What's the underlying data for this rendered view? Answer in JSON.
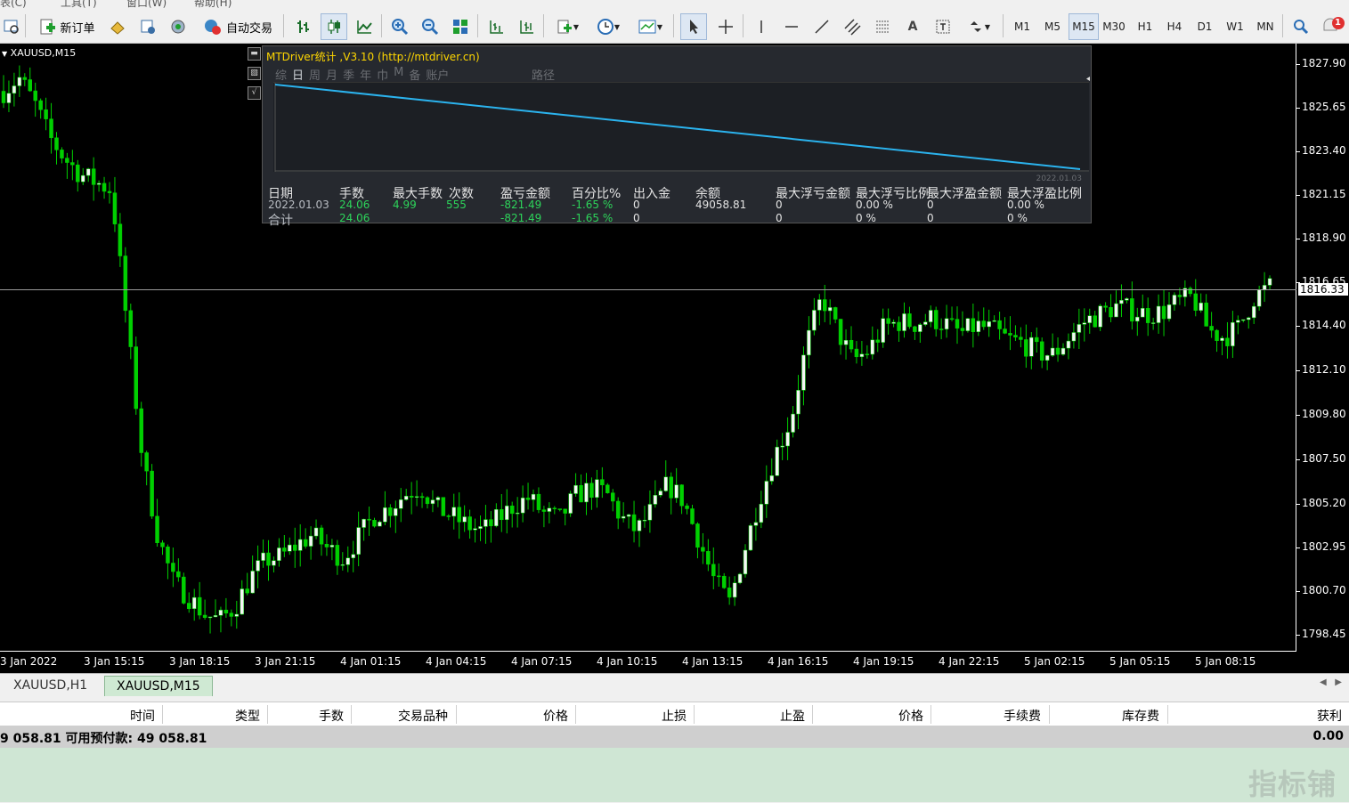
{
  "menubar": {
    "items": [
      "表(C)",
      "工具(T)",
      "窗口(W)",
      "帮助(H)"
    ]
  },
  "toolbar": {
    "new_order": "新订单",
    "auto_trade": "自动交易",
    "timeframes": [
      "M1",
      "M5",
      "M15",
      "M30",
      "H1",
      "H4",
      "D1",
      "W1",
      "MN"
    ],
    "active_timeframe": "M15",
    "notification_count": "1",
    "icons": [
      "properties-icon",
      "new-order-icon",
      "history-icon",
      "market-watch-icon",
      "signals-icon",
      "auto-trading-icon",
      "bar-chart-icon",
      "candlestick-icon",
      "line-chart-icon",
      "zoom-in-icon",
      "zoom-out-icon",
      "tile-windows-icon",
      "chart-shift-icon",
      "autoscroll-icon",
      "indicators-icon",
      "periodicity-icon",
      "templates-icon",
      "cursor-icon",
      "crosshair-icon",
      "vertical-line-icon",
      "horizontal-line-icon",
      "trendline-icon",
      "equidistant-channel-icon",
      "fibonacci-icon",
      "text-icon",
      "text-label-icon",
      "arrows-icon",
      "search-icon",
      "notification-icon"
    ]
  },
  "chart": {
    "symbol_label": "XAUUSD,M15",
    "current_price": "1816.33",
    "price_ticks": [
      "1827.90",
      "1825.65",
      "1823.40",
      "1821.15",
      "1818.90",
      "1816.65",
      "1814.40",
      "1812.10",
      "1809.80",
      "1807.50",
      "1805.20",
      "1802.95",
      "1800.70",
      "1798.45"
    ],
    "time_ticks": [
      "3 Jan 2022",
      "3 Jan 15:15",
      "3 Jan 18:15",
      "3 Jan 21:15",
      "4 Jan 01:15",
      "4 Jan 04:15",
      "4 Jan 07:15",
      "4 Jan 10:15",
      "4 Jan 13:15",
      "4 Jan 16:15",
      "4 Jan 19:15",
      "4 Jan 22:15",
      "5 Jan 02:15",
      "5 Jan 05:15",
      "5 Jan 08:15"
    ],
    "colors": {
      "bull": "#f5f5f5",
      "bear": "#00d000",
      "wick": "#00d000",
      "background": "#000000",
      "grid": "none"
    },
    "candles_close_path": [
      1826.5,
      1827.2,
      1825.9,
      1824.1,
      1823.0,
      1822.2,
      1821.8,
      1821.4,
      1814.4,
      1807.5,
      1803.5,
      1801.2,
      1800.4,
      1799.5,
      1799.2,
      1799.9,
      1801.4,
      1802.3,
      1802.5,
      1803.1,
      1803.6,
      1802.9,
      1802.4,
      1803.5,
      1804.6,
      1805.0,
      1805.7,
      1806.1,
      1805.0,
      1804.6,
      1804.1,
      1803.8,
      1804.4,
      1805.1,
      1805.5,
      1804.7,
      1804.4,
      1805.6,
      1806.0,
      1805.8,
      1804.5,
      1803.8,
      1804.9,
      1806.2,
      1805.4,
      1803.4,
      1801.3,
      1800.1,
      1802.9,
      1805.6,
      1807.8,
      1809.6,
      1813.4,
      1815.9,
      1814.1,
      1812.6,
      1813.1,
      1814.3,
      1814.6,
      1814.5,
      1814.8,
      1814.5,
      1814.0,
      1814.4,
      1814.2,
      1813.7,
      1813.5,
      1813.0,
      1812.9,
      1813.8,
      1814.6,
      1815.0,
      1815.4,
      1815.2,
      1815.0,
      1815.1,
      1815.6,
      1815.9,
      1814.2,
      1813.8,
      1814.3,
      1815.9,
      1816.4
    ]
  },
  "indicator_panel": {
    "title": "MTDriver统计 ,V3.10 (http://mtdriver.cn)",
    "tabs": [
      "综",
      "日",
      "周",
      "月",
      "季",
      "年",
      "巾",
      "M",
      "备",
      "账户"
    ],
    "active_tab": "日",
    "path_label": "路径",
    "graph_date": "2022.01.03",
    "columns": [
      "日期",
      "手数",
      "最大手数",
      "次数",
      "盈亏金额",
      "百分比%",
      "出入金",
      "余额",
      "最大浮亏金额",
      "最大浮亏比例",
      "最大浮盈金额",
      "最大浮盈比例"
    ],
    "rows": [
      {
        "date": "2022.01.03",
        "lots": "24.06",
        "max_lots": "4.99",
        "count": "555",
        "pnl": "-821.49",
        "pct": "-1.65 %",
        "deposit": "0",
        "balance": "49058.81",
        "max_float_loss": "0",
        "max_float_loss_pct": "0.00 %",
        "max_float_profit": "0",
        "max_float_profit_pct": "0.00 %"
      }
    ],
    "total": {
      "label": "合计",
      "lots": "24.06",
      "pnl": "-821.49",
      "pct": "-1.65 %",
      "deposit": "0",
      "max_float_loss": "0",
      "max_float_loss_pct": "0 %",
      "max_float_profit": "0",
      "max_float_profit_pct": "0 %"
    }
  },
  "chart_tabs": [
    {
      "label": "XAUUSD,H1",
      "active": false
    },
    {
      "label": "XAUUSD,M15",
      "active": true
    }
  ],
  "terminal": {
    "columns": [
      "时间",
      "类型",
      "手数",
      "交易品种",
      "价格",
      "止损",
      "止盈",
      "价格",
      "手续费",
      "库存费",
      "获利"
    ],
    "balance_text": "9 058.81  可用预付款: 49 058.81",
    "profit_total": "0.00",
    "watermark": "指标铺"
  }
}
